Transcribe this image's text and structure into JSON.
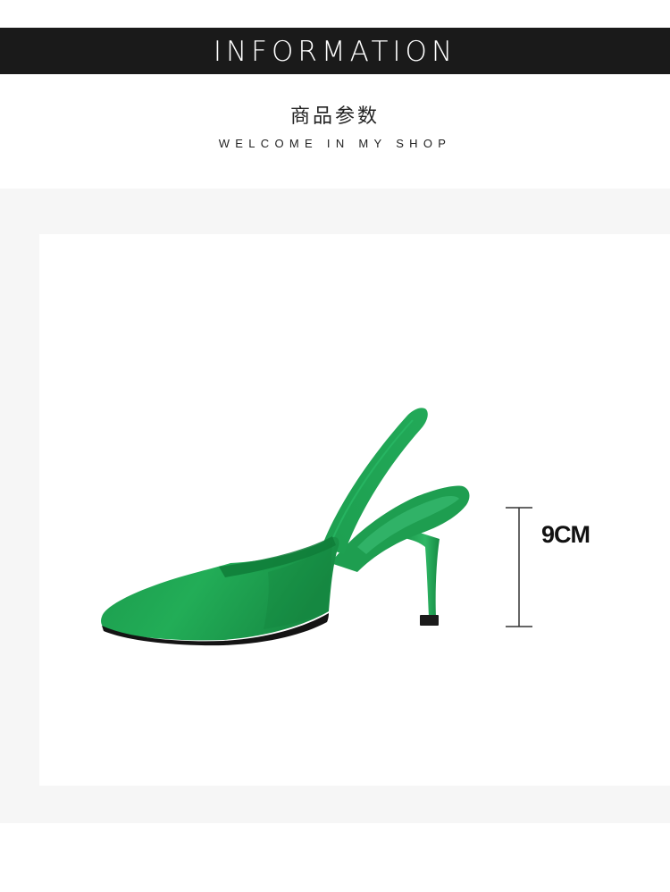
{
  "header": {
    "title": "INFORMATION",
    "subtitle_cn": "商品参数",
    "subtitle_en": "WELCOME IN MY SHOP"
  },
  "product": {
    "image_icon": "green-slingback-pump-image",
    "shoe_color": "#1f9e4f",
    "heel_height_label": "9CM"
  },
  "colors": {
    "banner_bg": "#1a1a1a",
    "panel_bg": "#f6f6f6",
    "card_bg": "#ffffff"
  }
}
